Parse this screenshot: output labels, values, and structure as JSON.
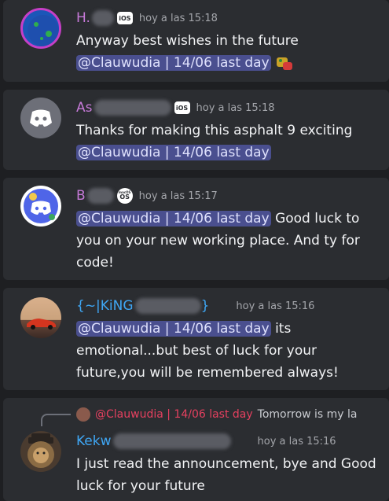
{
  "messages": [
    {
      "username": "H.",
      "username_color": "#c67ad8",
      "badge": "iOS",
      "timestamp": "hoy a las 15:18",
      "text_before": "Anyway best wishes in the future",
      "mention": "@Clauwudia | 14/06 last day",
      "text_after": ""
    },
    {
      "username": "As",
      "username_color": "#c67ad8",
      "badge": "iOS",
      "timestamp": "hoy a las 15:18",
      "text_before": "Thanks for making this asphalt 9 exciting",
      "mention": "@Clauwudia | 14/06 last day",
      "text_after": ""
    },
    {
      "username": "B",
      "username_color": "#c67ad8",
      "badge": "macOS",
      "badge_sub": "OS",
      "timestamp": "hoy a las 15:17",
      "mention": "@Clauwudia | 14/06 last day",
      "text_after": " Good luck to you on your new working place. And ty for code!"
    },
    {
      "username": "{~|KiNG",
      "username_suffix": "}",
      "username_color": "#3fa7f5",
      "timestamp": "hoy a las 15:16",
      "mention": "@Clauwudia | 14/06 last day",
      "text_after": " its emotional...but best of luck for your future,you will be remembered always!"
    },
    {
      "username": "Kekw",
      "username_color": "#3fa7f5",
      "timestamp": "hoy a las 15:16",
      "reply_mention": "@Clauwudia | 14/06 last day",
      "reply_text": "Tomorrow is my la",
      "text": "I just read the announcement, bye and Good luck for your future"
    }
  ]
}
